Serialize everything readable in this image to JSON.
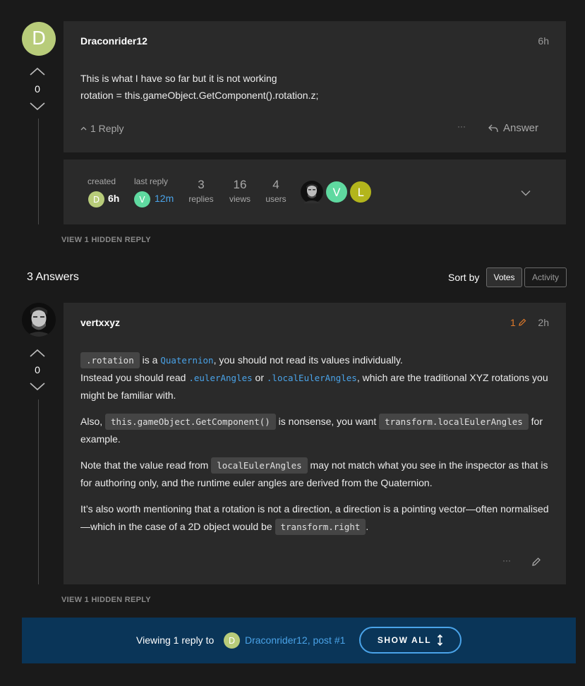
{
  "question_post": {
    "avatar_letter": "D",
    "vote_count": "0",
    "author": "Draconrider12",
    "time": "6h",
    "body_line1": "This is what I have so far but it is not working",
    "body_line2": "rotation = this.gameObject.GetComponent().rotation.z;",
    "reply_toggle": "1 Reply",
    "more": "···",
    "answer_label": "Answer"
  },
  "topic_map": {
    "created_label": "created",
    "created_avatar": "D",
    "created_time": "6h",
    "last_reply_label": "last reply",
    "last_reply_avatar": "V",
    "last_reply_time": "12m",
    "replies_count": "3",
    "replies_label": "replies",
    "views_count": "16",
    "views_label": "views",
    "users_count": "4",
    "users_label": "users",
    "participant_v": "V",
    "participant_l": "L"
  },
  "hidden_reply_1": "VIEW 1 HIDDEN REPLY",
  "answers_header": {
    "title": "3 Answers",
    "sort_label": "Sort by",
    "votes": "Votes",
    "activity": "Activity"
  },
  "answer_post": {
    "author": "vertxxyz",
    "vote_count": "0",
    "edit_count": "1",
    "time": "2h",
    "p1_code1": ".rotation",
    "p1_t1": " is a ",
    "p1_link1": "Quaternion",
    "p1_t2": ", you should not read its values individually.",
    "p1_t3": "Instead you should read ",
    "p1_link2": ".eulerAngles",
    "p1_t4": " or ",
    "p1_link3": ".localEulerAngles",
    "p1_t5": ", which are the traditional XYZ rotations you might be familiar with.",
    "p2_t1": "Also, ",
    "p2_code1": "this.gameObject.GetComponent()",
    "p2_t2": " is nonsense, you want ",
    "p2_code2": "transform.localEulerAngles",
    "p2_t3": " for example.",
    "p3_t1": "Note that the value read from ",
    "p3_code1": "localEulerAngles",
    "p3_t2": " may not match what you see in the inspector as that is for authoring only, and the runtime euler angles are derived from the Quaternion.",
    "p4_t1": "It’s also worth mentioning that a rotation is not a direction, a direction is a pointing vector—often normalised—which in the case of a 2D object would be ",
    "p4_code1": "transform.right",
    "p4_t2": ".",
    "more": "···"
  },
  "hidden_reply_2": "VIEW 1 HIDDEN REPLY",
  "footer_banner": {
    "viewing_text": "Viewing 1 reply to",
    "avatar": "D",
    "link_text": "Draconrider12, post #1",
    "show_all": "SHOW ALL"
  },
  "colors": {
    "avatar_d": "#b8cc7a",
    "avatar_v": "#5fd9a0",
    "avatar_l": "#b3b51c",
    "link_blue": "#4aa3e8",
    "edit_orange": "#e07a2a",
    "banner_bg": "#0a3558"
  }
}
